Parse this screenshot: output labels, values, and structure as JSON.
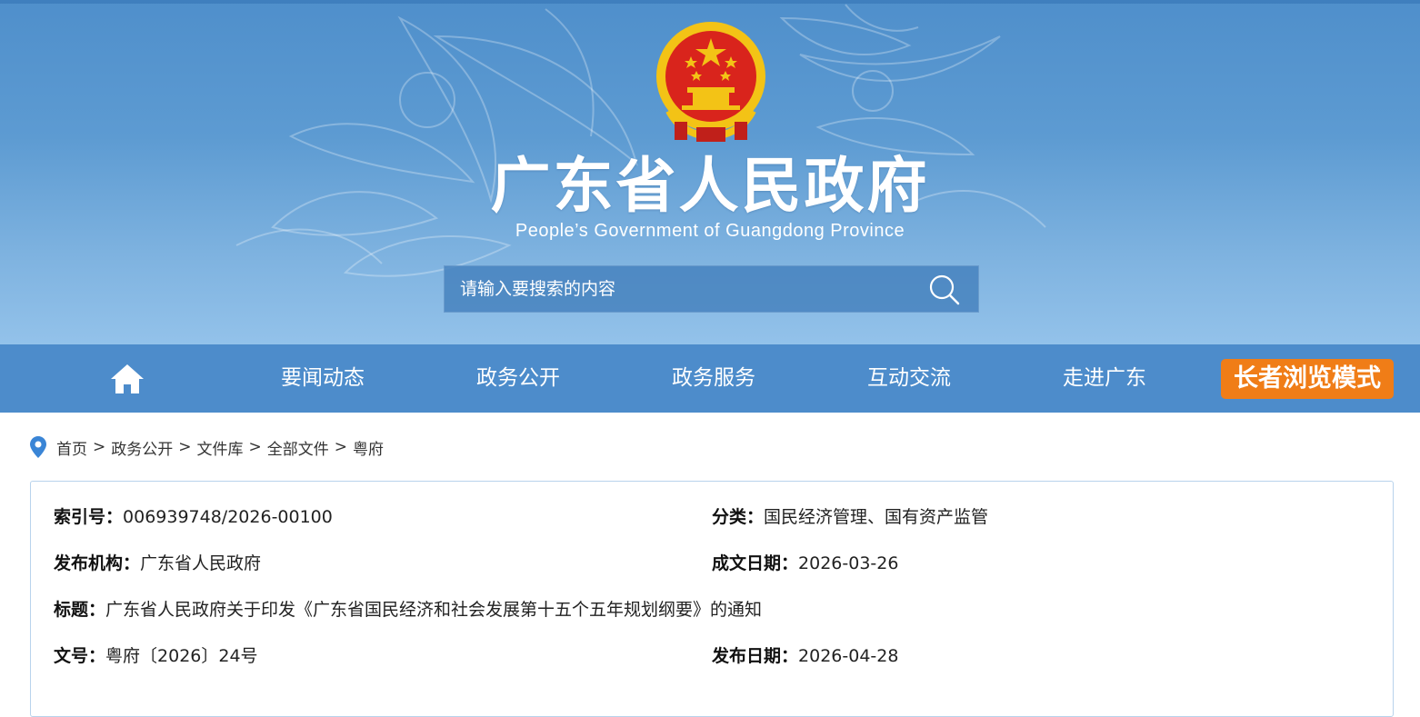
{
  "header": {
    "site_title": "广东省人民政府",
    "site_subtitle": "People’s Government of Guangdong Province",
    "emblem_icon": "national-emblem-icon"
  },
  "search": {
    "placeholder": "请输入要搜索的内容",
    "value": "",
    "icon": "search-icon"
  },
  "nav": {
    "home_icon": "home-icon",
    "items": [
      {
        "label": "要闻动态"
      },
      {
        "label": "政务公开"
      },
      {
        "label": "政务服务"
      },
      {
        "label": "互动交流"
      },
      {
        "label": "走进广东"
      }
    ],
    "elder_mode_label": "长者浏览模式"
  },
  "breadcrumb": {
    "icon": "location-pin-icon",
    "separator": ">",
    "items": [
      "首页",
      "政务公开",
      "文件库",
      "全部文件",
      "粤府"
    ]
  },
  "document_info": {
    "index_label": "索引号：",
    "index_value": "006939748/2026-00100",
    "category_label": "分类：",
    "category_value": "国民经济管理、国有资产监管",
    "issuer_label": "发布机构：",
    "issuer_value": "广东省人民政府",
    "written_date_label": "成文日期：",
    "written_date_value": "2026-03-26",
    "title_label": "标题：",
    "title_value": "广东省人民政府关于印发《广东省国民经济和社会发展第十五个五年规划纲要》的通知",
    "doc_no_label": "文号：",
    "doc_no_value": "粤府〔2026〕24号",
    "publish_date_label": "发布日期：",
    "publish_date_value": "2026-04-28"
  },
  "colors": {
    "banner_top": "#4f8fcb",
    "banner_bottom": "#93c2ea",
    "nav_bg": "#4d8ccb",
    "elder_btn": "#f07d17",
    "panel_border": "#b8d3ec",
    "emblem_red": "#d9241c",
    "emblem_gold": "#f3c316"
  }
}
